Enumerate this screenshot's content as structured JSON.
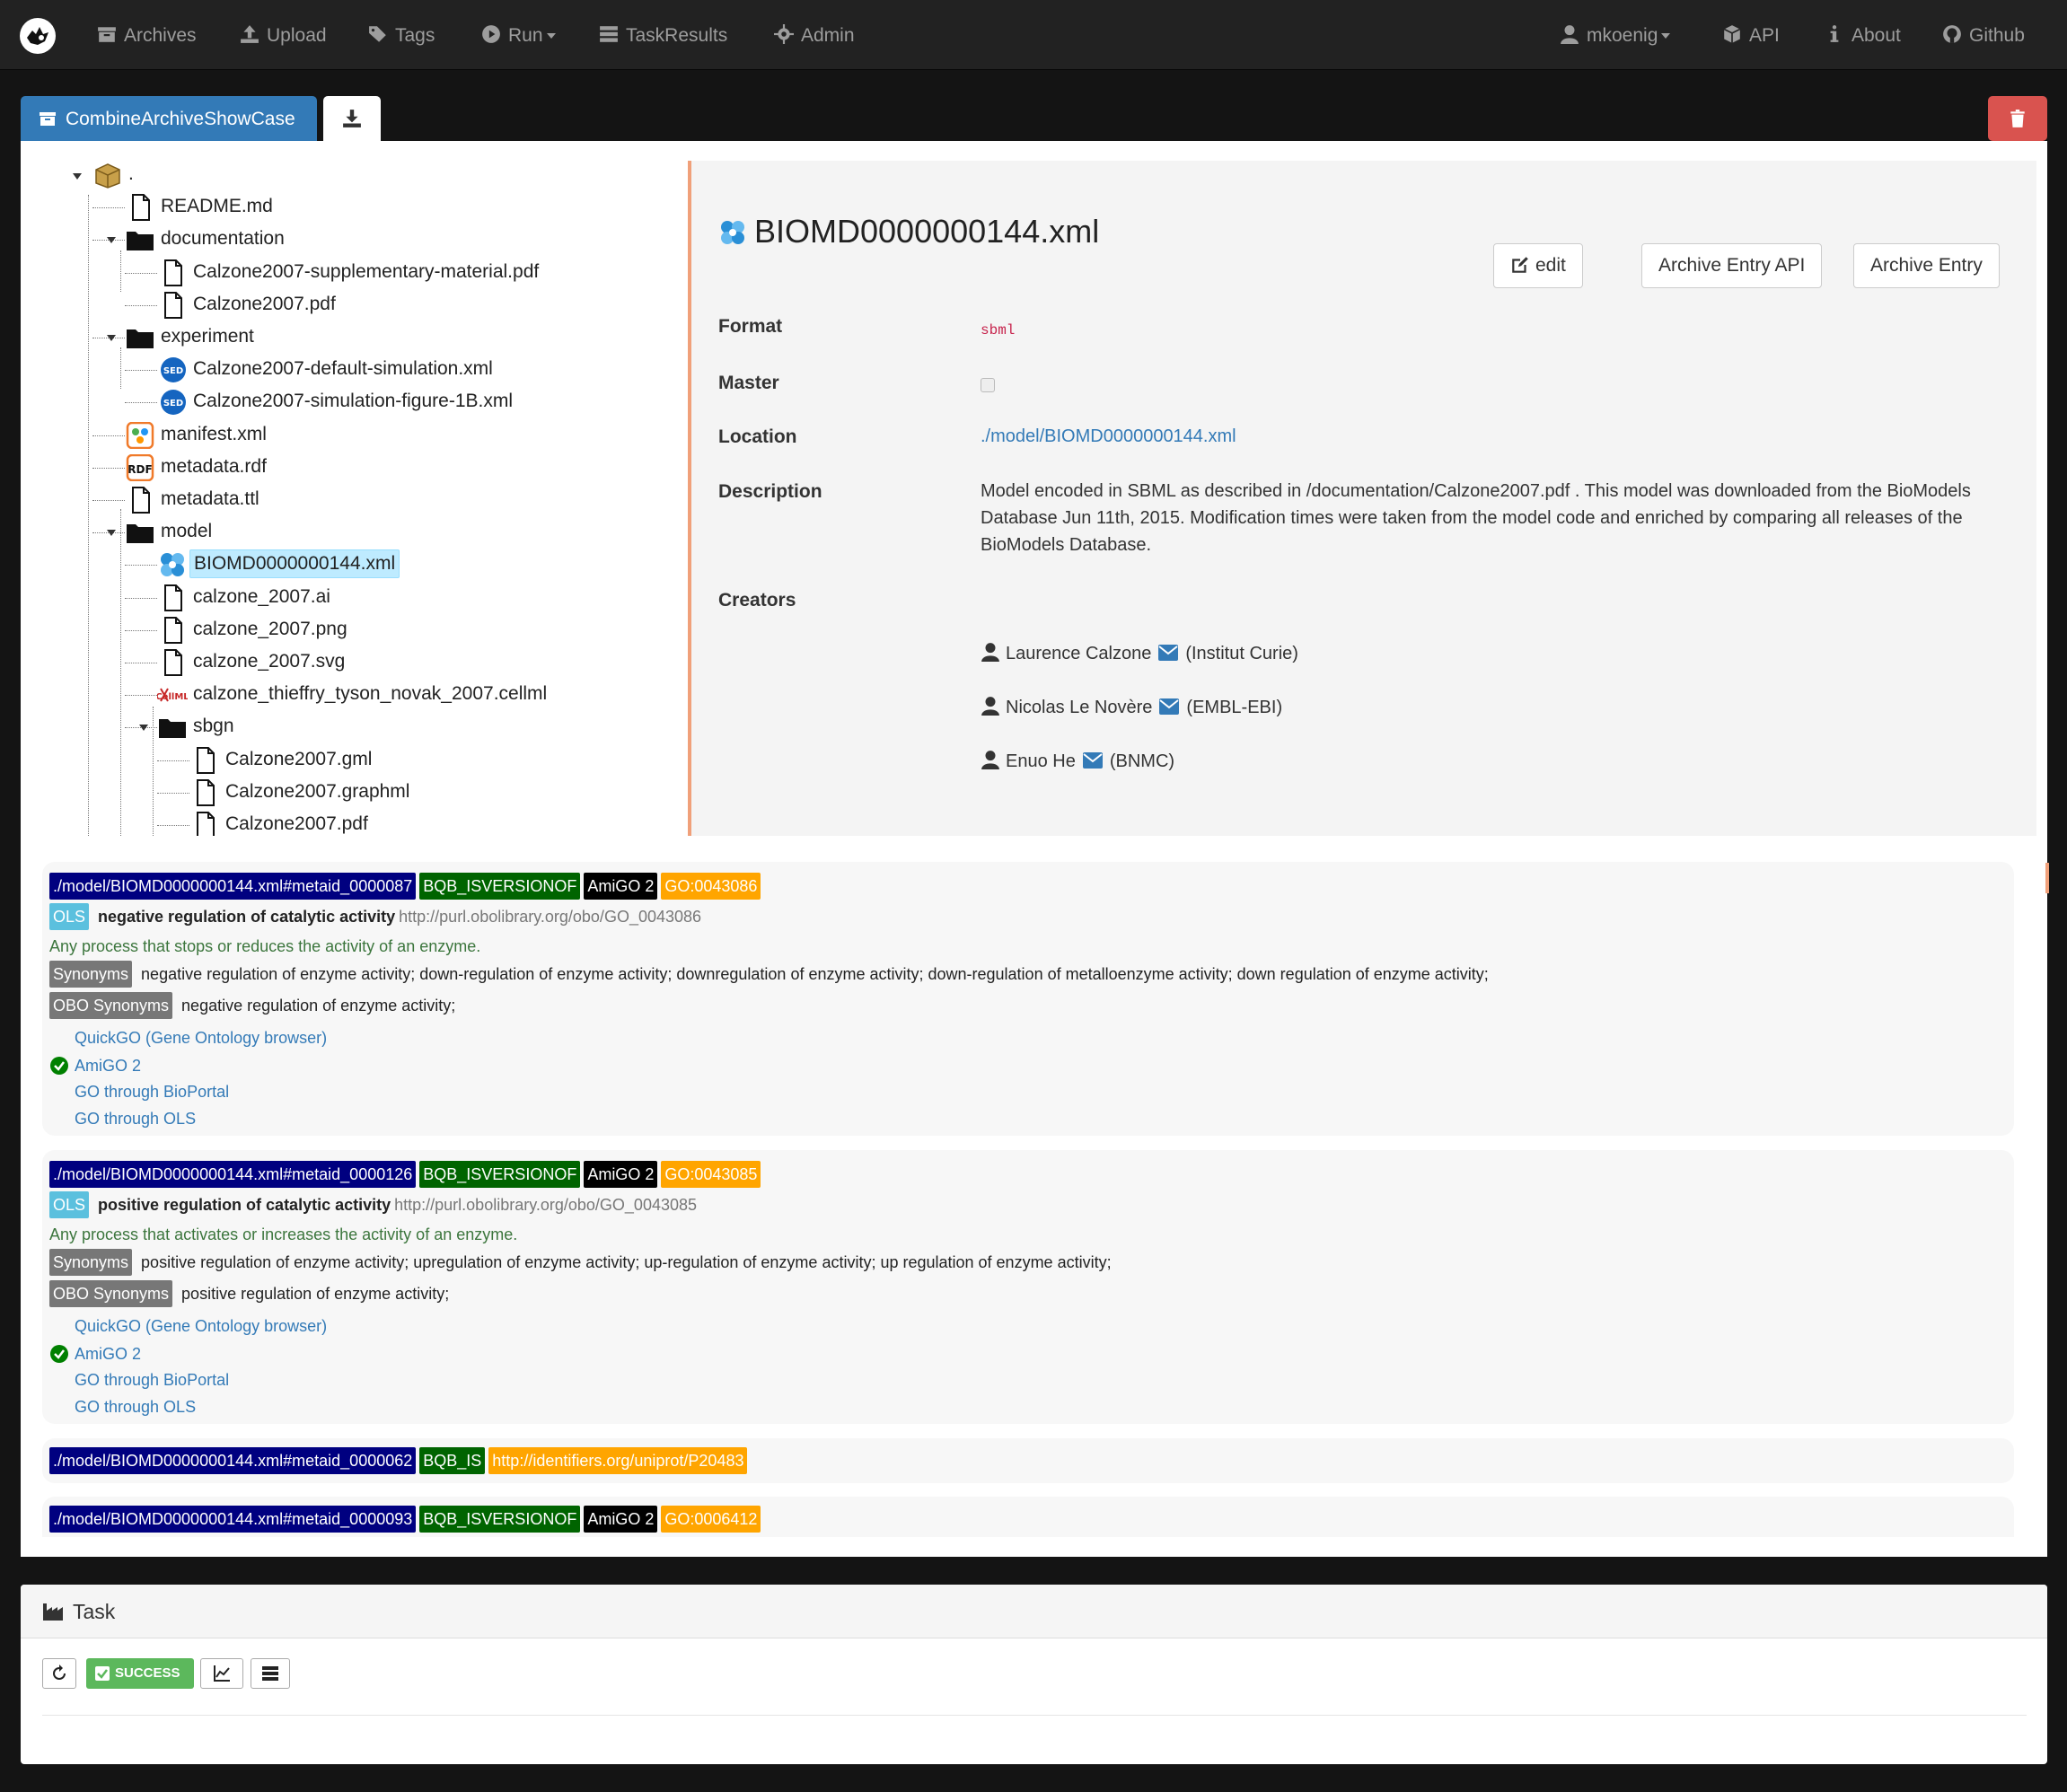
{
  "navbar": {
    "items": [
      {
        "label": "Archives",
        "icon": "archive-icon"
      },
      {
        "label": "Upload",
        "icon": "upload-icon"
      },
      {
        "label": "Tags",
        "icon": "tags-icon"
      },
      {
        "label": "Run",
        "icon": "play-icon"
      },
      {
        "label": "TaskResults",
        "icon": "tasks-icon"
      },
      {
        "label": "Admin",
        "icon": "gear-icon"
      },
      {
        "label": "mkoenig",
        "icon": "user-icon"
      },
      {
        "label": "API",
        "icon": "cube-icon"
      },
      {
        "label": "About",
        "icon": "info-icon"
      },
      {
        "label": "Github",
        "icon": "github-icon"
      }
    ]
  },
  "archive": {
    "tab_label": "CombineArchiveShowCase"
  },
  "tree": {
    "root_label": ".",
    "nodes": [
      "README.md",
      "documentation",
      "Calzone2007-supplementary-material.pdf",
      "Calzone2007.pdf",
      "experiment",
      "Calzone2007-default-simulation.xml",
      "Calzone2007-simulation-figure-1B.xml",
      "manifest.xml",
      "metadata.rdf",
      "metadata.ttl",
      "model",
      "BIOMD0000000144.xml",
      "calzone_2007.ai",
      "calzone_2007.png",
      "calzone_2007.svg",
      "calzone_thieffry_tyson_novak_2007.cellml",
      "sbgn",
      "Calzone2007.gml",
      "Calzone2007.graphml",
      "Calzone2007.pdf"
    ]
  },
  "detail": {
    "title": "BIOMD0000000144.xml",
    "buttons": {
      "edit": "edit",
      "api": "Archive Entry API",
      "entry": "Archive Entry"
    },
    "labels": {
      "format": "Format",
      "master": "Master",
      "location": "Location",
      "description": "Description",
      "creators": "Creators"
    },
    "format": "sbml",
    "location": "./model/BIOMD0000000144.xml",
    "description": "Model encoded in SBML as described in /documentation/Calzone2007.pdf . This model was downloaded from the BioModels Database Jun 11th, 2015. Modification times were taken from the model code and enriched by comparing all releases of the BioModels Database.",
    "creators": [
      {
        "name": "Laurence Calzone",
        "org": "(Institut Curie)"
      },
      {
        "name": "Nicolas Le Novère",
        "org": "(EMBL-EBI)"
      },
      {
        "name": "Enuo He",
        "org": "(BNMC)"
      }
    ]
  },
  "annotations": [
    {
      "subject": "./model/BIOMD0000000144.xml#metaid_0000087",
      "qualifier": "BQB_ISVERSIONOF",
      "collection": "AmiGO 2",
      "resource": "GO:0043086",
      "ols": "OLS",
      "term": "negative regulation of catalytic activity",
      "iri": "http://purl.obolibrary.org/obo/GO_0043086",
      "definition": "Any process that stops or reduces the activity of an enzyme.",
      "synonyms_label": "Synonyms",
      "synonyms": "negative regulation of enzyme activity; down-regulation of enzyme activity; downregulation of enzyme activity; down-regulation of metalloenzyme activity; down regulation of enzyme activity;",
      "obo_synonyms_label": "OBO Synonyms",
      "obo_synonyms": "negative regulation of enzyme activity;",
      "links": [
        "QuickGO (Gene Ontology browser)",
        "AmiGO 2",
        "GO through BioPortal",
        "GO through OLS"
      ]
    },
    {
      "subject": "./model/BIOMD0000000144.xml#metaid_0000126",
      "qualifier": "BQB_ISVERSIONOF",
      "collection": "AmiGO 2",
      "resource": "GO:0043085",
      "ols": "OLS",
      "term": "positive regulation of catalytic activity",
      "iri": "http://purl.obolibrary.org/obo/GO_0043085",
      "definition": "Any process that activates or increases the activity of an enzyme.",
      "synonyms_label": "Synonyms",
      "synonyms": "positive regulation of enzyme activity; upregulation of enzyme activity; up-regulation of enzyme activity; up regulation of enzyme activity;",
      "obo_synonyms_label": "OBO Synonyms",
      "obo_synonyms": "positive regulation of enzyme activity;",
      "links": [
        "QuickGO (Gene Ontology browser)",
        "AmiGO 2",
        "GO through BioPortal",
        "GO through OLS"
      ]
    },
    {
      "subject": "./model/BIOMD0000000144.xml#metaid_0000062",
      "qualifier": "BQB_IS",
      "resource": "http://identifiers.org/uniprot/P20483"
    },
    {
      "subject": "./model/BIOMD0000000144.xml#metaid_0000093",
      "qualifier": "BQB_ISVERSIONOF",
      "collection": "AmiGO 2",
      "resource": "GO:0006412"
    }
  ],
  "task": {
    "title": "Task",
    "status": "SUCCESS"
  },
  "colors": {
    "primary": "#337ab7",
    "danger": "#d9534f",
    "success": "#5cb85c",
    "navbar": "#222222",
    "accent": "#f0a07a"
  }
}
